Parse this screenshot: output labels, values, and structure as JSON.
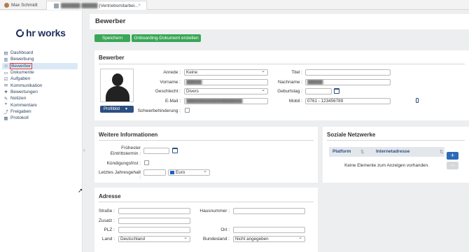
{
  "tabs": [
    {
      "label": "Max Schmidt"
    },
    {
      "label_hidden": "██████ █████",
      "label": "(Vertriebsmitarbei..."
    }
  ],
  "logo": {
    "text": "hr works"
  },
  "sidebar": {
    "items": [
      {
        "label": "Dashboard",
        "icon": "dashboard-icon",
        "glyph": "▤"
      },
      {
        "label": "Bewerbung",
        "icon": "application-icon",
        "glyph": "▥"
      },
      {
        "label": "Bewerber",
        "icon": "applicant-icon",
        "glyph": "☺"
      },
      {
        "label": "Dokumente",
        "icon": "documents-icon",
        "glyph": "▭"
      },
      {
        "label": "Aufgaben",
        "icon": "tasks-icon",
        "glyph": "☑"
      },
      {
        "label": "Kommunikation",
        "icon": "communication-icon",
        "glyph": "✉"
      },
      {
        "label": "Bewertungen",
        "icon": "star-icon",
        "glyph": "★"
      },
      {
        "label": "Notizen",
        "icon": "notes-icon",
        "glyph": "✎"
      },
      {
        "label": "Kommentare",
        "icon": "comments-icon",
        "glyph": "❞"
      },
      {
        "label": "Freigaben",
        "icon": "share-icon",
        "glyph": "⤴"
      },
      {
        "label": "Protokoll",
        "icon": "log-icon",
        "glyph": "▦"
      }
    ]
  },
  "page": {
    "title": "Bewerber",
    "save_label": "Speichern",
    "onboarding_label": "Onboarding-Dokument erstellen"
  },
  "bewerber": {
    "heading": "Bewerber",
    "profilbild_label": "Profilbild",
    "anrede_label": "Anrede :",
    "anrede_value": "Keine",
    "vorname_label": "Vorname :",
    "vorname_value": "█████",
    "geschlecht_label": "Geschlecht :",
    "geschlecht_value": "Divers",
    "email_label": "E-Mail :",
    "email_value": "██████████████████",
    "schwerbehinderung_label": "Schwerbehinderung :",
    "titel_label": "Titel :",
    "titel_value": "",
    "nachname_label": "Nachname :",
    "nachname_value": "█████",
    "geburtstag_label": "Geburtstag :",
    "geburtstag_value": "",
    "mobil_label": "Mobil :",
    "mobil_value": "0761 - 123456789"
  },
  "weitere": {
    "heading": "Weitere Informationen",
    "eintritt_label_1": "Frühester",
    "eintritt_label_2": "Eintrittstermin :",
    "kuendigung_label": "Kündigungsfrist :",
    "gehalt_label": "Letztes Jahresgehalt :",
    "gehalt_value": "",
    "currency_value": "Euro"
  },
  "soziale": {
    "heading": "Soziale Netzwerke",
    "col_platform": "Platform",
    "col_address": "Internetadresse",
    "empty_text": "Keine Elemente zum Anzeigen vorhanden.",
    "add_glyph": "+",
    "remove_glyph": "−"
  },
  "adresse": {
    "heading": "Adresse",
    "strasse_label": "Straße :",
    "zusatz_label": "Zusatz :",
    "plz_label": "PLZ :",
    "land_label": "Land :",
    "land_value": "Deutschland",
    "hausnummer_label": "Hausnummer :",
    "ort_label": "Ort :",
    "bundesland_label": "Bundesland :",
    "bundesland_value": "Nicht angegeben"
  },
  "colors": {
    "accent_green": "#3aa657",
    "navy": "#2c4f82",
    "active_nav": "#dbe8f6"
  }
}
